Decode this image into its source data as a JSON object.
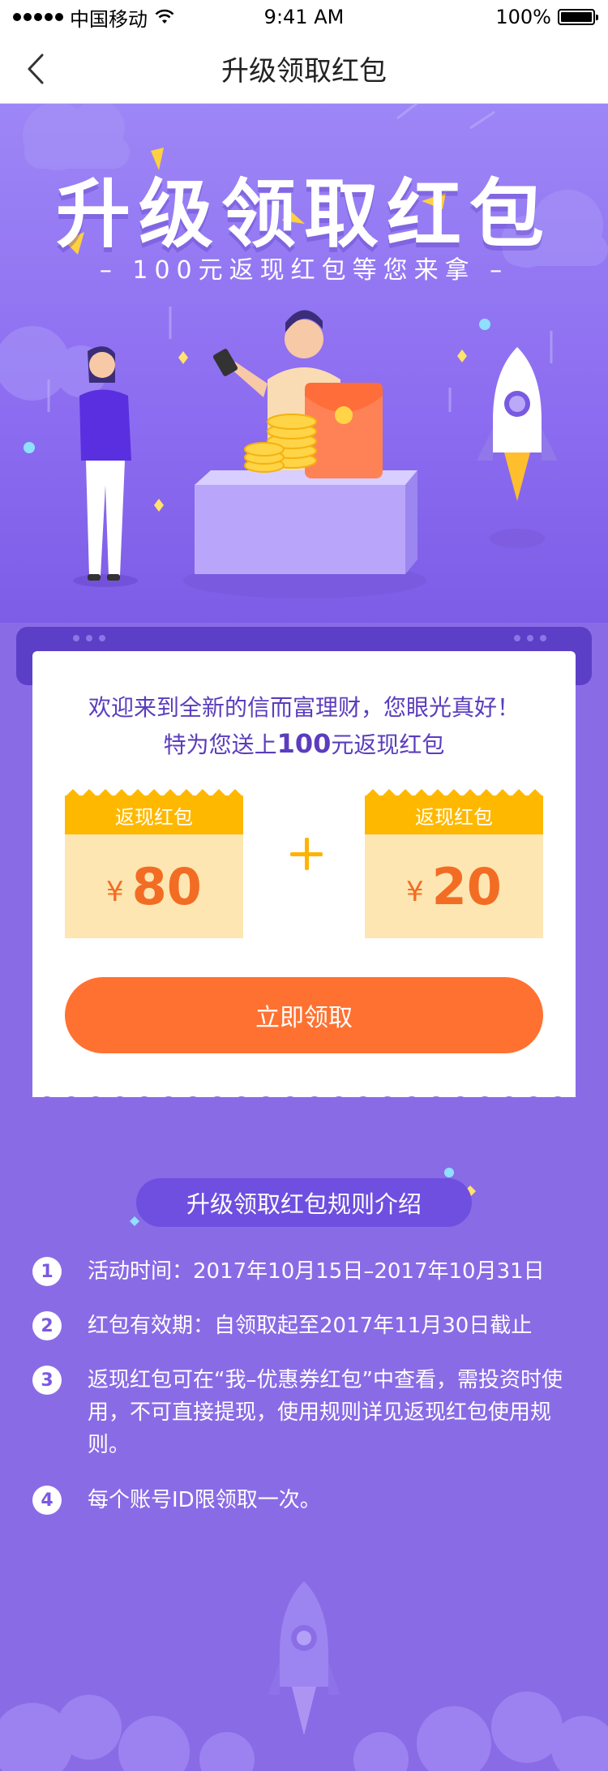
{
  "status_bar": {
    "carrier": "中国移动",
    "time": "9:41 AM",
    "battery": "100%"
  },
  "nav": {
    "title": "升级领取红包"
  },
  "hero": {
    "title": "升级领取红包",
    "subtitle": "– 100元返现红包等您来拿 –"
  },
  "card": {
    "welcome_line1": "欢迎来到全新的信而富理财，您眼光真好！",
    "welcome_line2_prefix": "特为您送上",
    "welcome_line2_amount": "100",
    "welcome_line2_suffix": "元返现红包",
    "coupons": [
      {
        "label": "返现红包",
        "currency": "¥",
        "amount": "80"
      },
      {
        "label": "返现红包",
        "currency": "¥",
        "amount": "20"
      }
    ],
    "claim_button": "立即领取"
  },
  "rules": {
    "title": "升级领取红包规则介绍",
    "items": [
      {
        "num": "1",
        "text": "活动时间：2017年10月15日–2017年10月31日"
      },
      {
        "num": "2",
        "text": "红包有效期：自领取起至2017年11月30日截止"
      },
      {
        "num": "3",
        "text": "返现红包可在“我–优惠券红包”中查看，需投资时使用，不可直接提现，使用规则详见返现红包使用规则。"
      },
      {
        "num": "4",
        "text": "每个账号ID限领取一次。"
      }
    ]
  },
  "colors": {
    "primary_purple": "#8a6be6",
    "dark_purple": "#5b3dbd",
    "accent_orange": "#ff7130",
    "coupon_yellow": "#ffb800",
    "coupon_body": "#fde6b1"
  }
}
